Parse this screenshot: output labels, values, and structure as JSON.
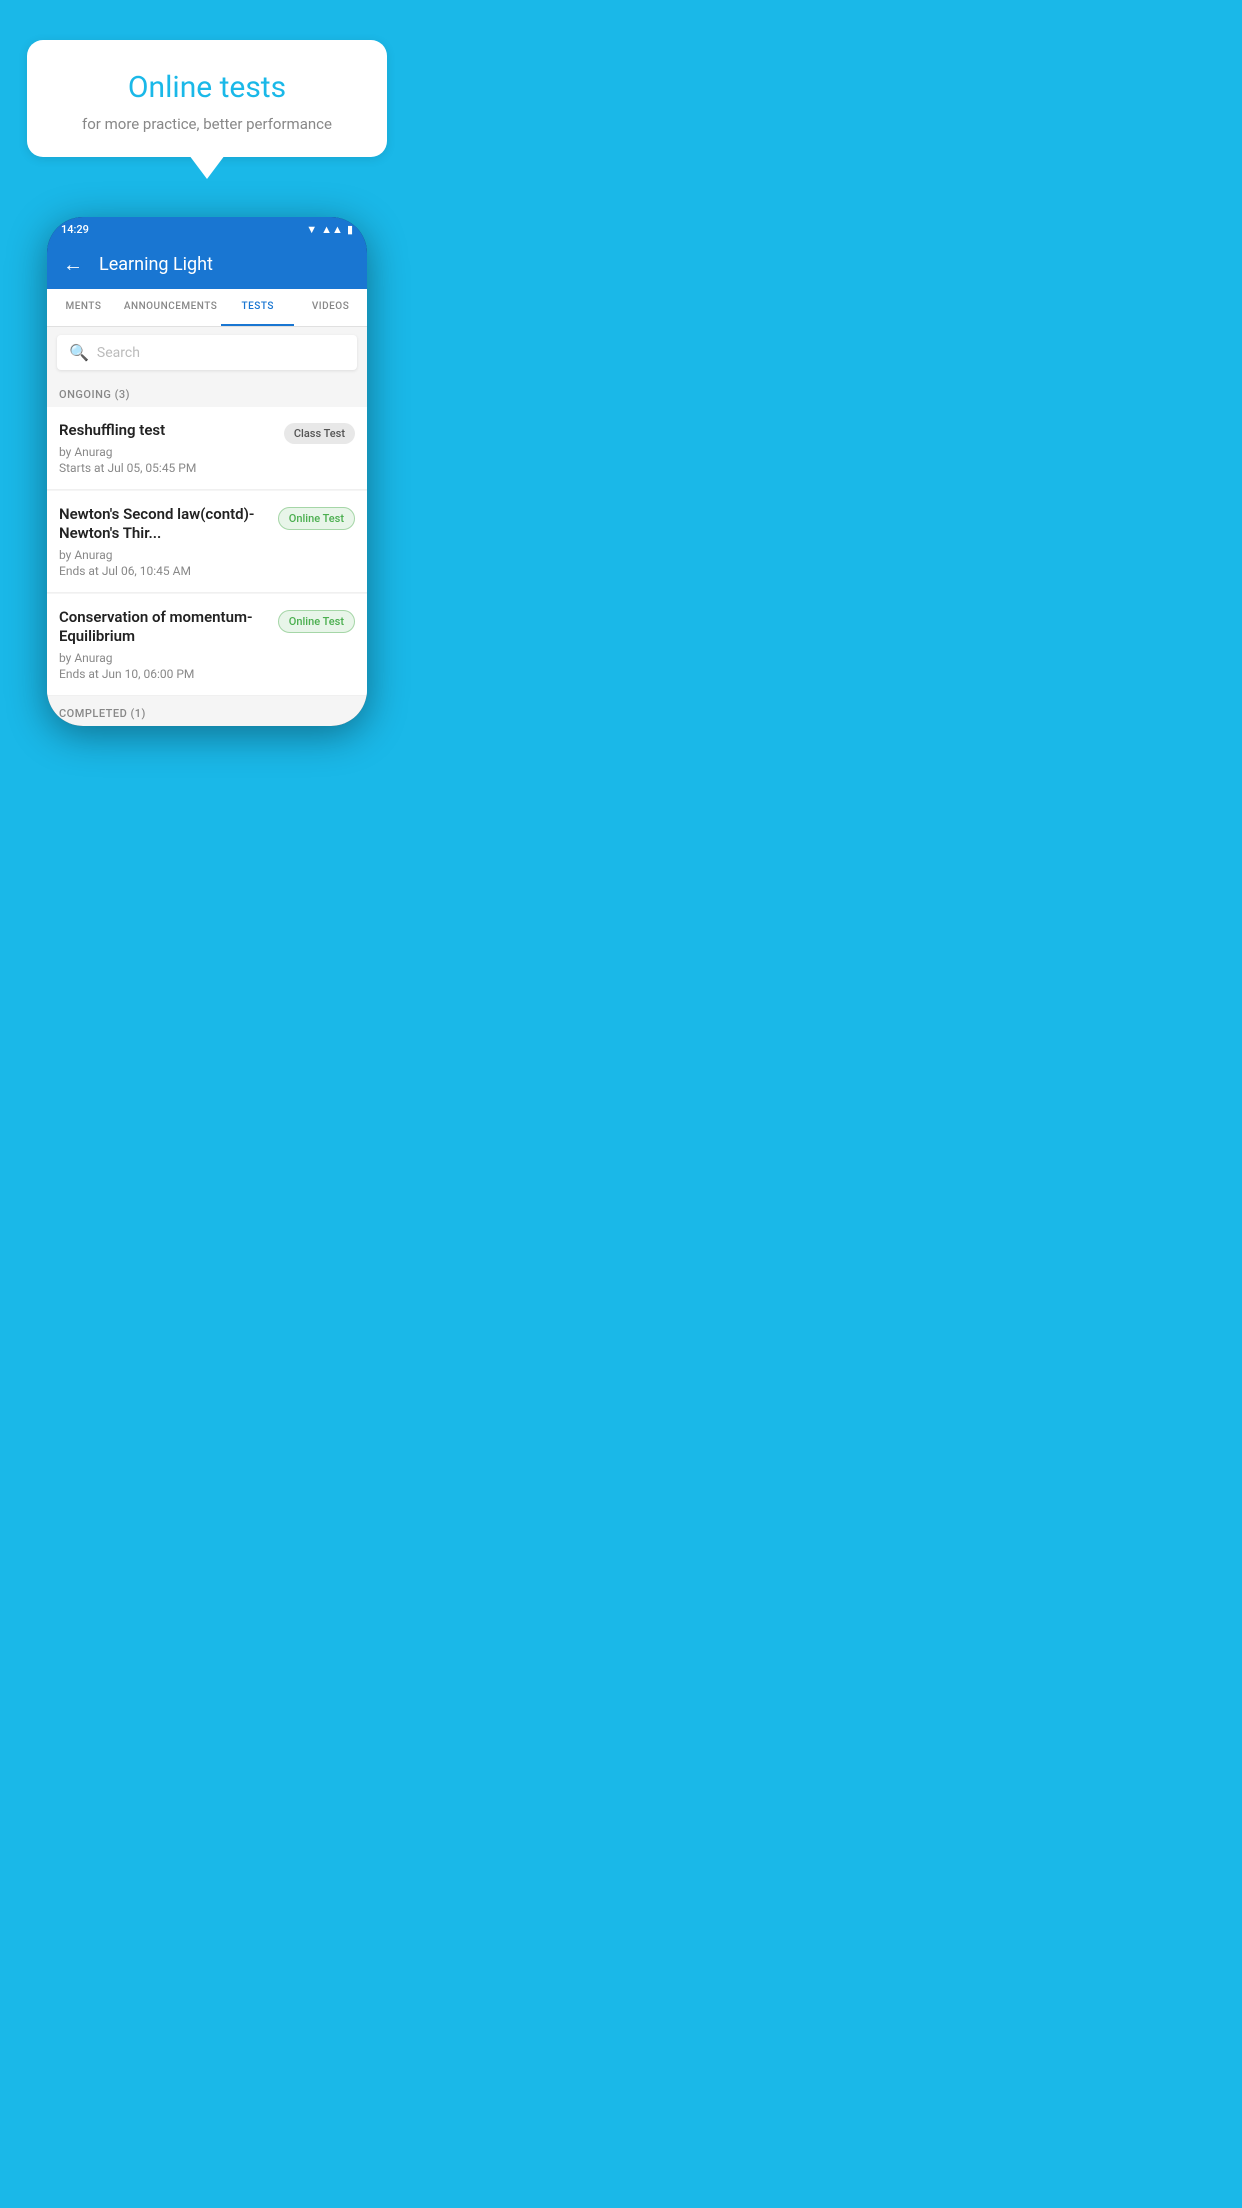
{
  "hero": {
    "bubble_title": "Online tests",
    "bubble_subtitle": "for more practice, better performance"
  },
  "phone": {
    "status_time": "14:29",
    "app_title": "Learning Light"
  },
  "tabs": [
    {
      "label": "MENTS",
      "active": false
    },
    {
      "label": "ANNOUNCEMENTS",
      "active": false
    },
    {
      "label": "TESTS",
      "active": true
    },
    {
      "label": "VIDEOS",
      "active": false
    }
  ],
  "search": {
    "placeholder": "Search"
  },
  "ongoing_section": {
    "label": "ONGOING (3)"
  },
  "tests": [
    {
      "name": "Reshuffling test",
      "author": "by Anurag",
      "time": "Starts at  Jul 05, 05:45 PM",
      "badge": "Class Test",
      "badge_type": "class"
    },
    {
      "name": "Newton's Second law(contd)-Newton's Thir...",
      "author": "by Anurag",
      "time": "Ends at  Jul 06, 10:45 AM",
      "badge": "Online Test",
      "badge_type": "online"
    },
    {
      "name": "Conservation of momentum-Equilibrium",
      "author": "by Anurag",
      "time": "Ends at  Jun 10, 06:00 PM",
      "badge": "Online Test",
      "badge_type": "online"
    }
  ],
  "completed_label": "COMPLETED (1)"
}
